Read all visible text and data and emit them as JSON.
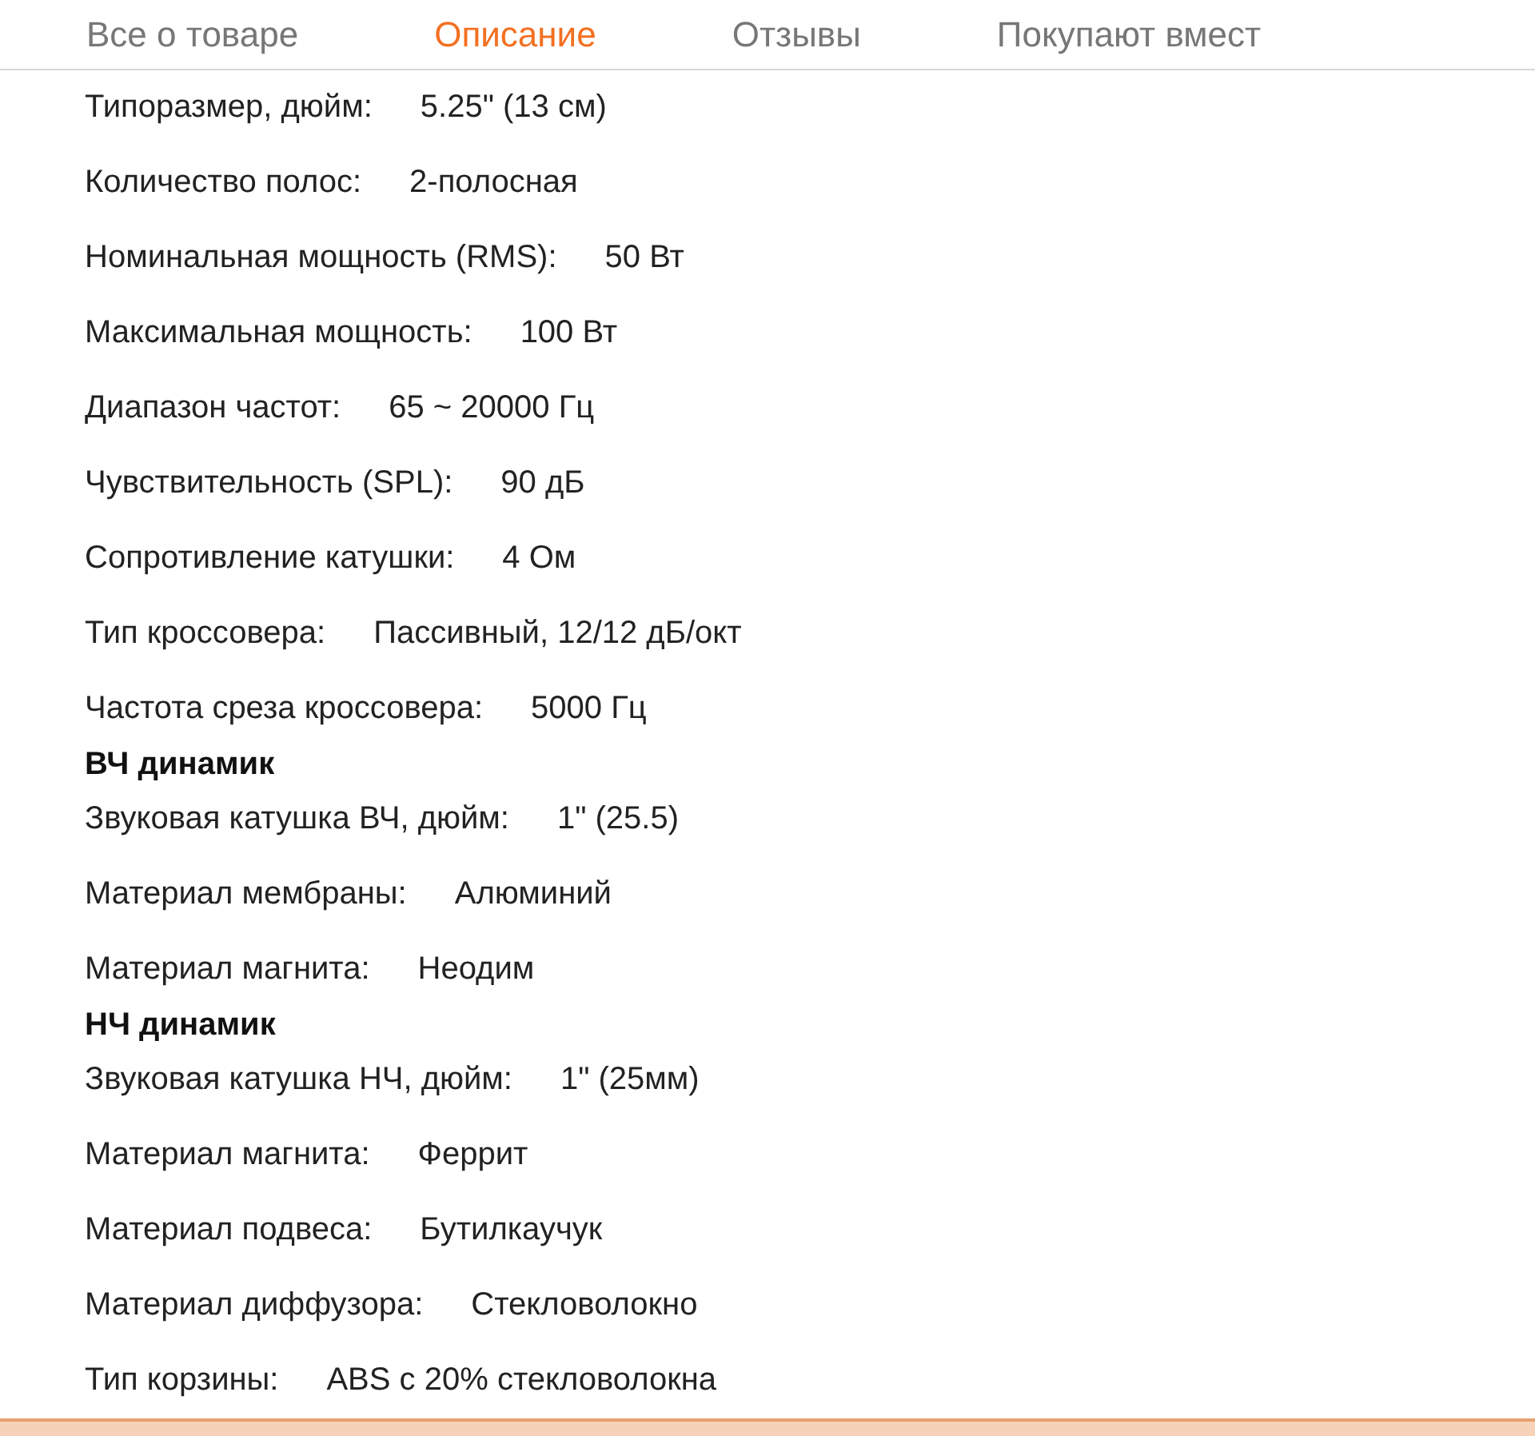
{
  "tabs": [
    {
      "label": "Все о товаре",
      "selected": false
    },
    {
      "label": "Описание",
      "selected": true
    },
    {
      "label": "Отзывы",
      "selected": false
    },
    {
      "label": "Покупают вмест",
      "selected": false
    }
  ],
  "specs": [
    {
      "kind": "row",
      "label": "Типоразмер, дюйм:",
      "value": "5.25\" (13 см)"
    },
    {
      "kind": "row",
      "label": "Количество полос:",
      "value": "2-полосная"
    },
    {
      "kind": "row",
      "label": "Номинальная мощность (RMS):",
      "value": "50 Вт"
    },
    {
      "kind": "row",
      "label": "Максимальная мощность:",
      "value": "100 Вт"
    },
    {
      "kind": "row",
      "label": "Диапазон частот:",
      "value": "65 ~ 20000 Гц"
    },
    {
      "kind": "row",
      "label": "Чувствительность (SPL):",
      "value": "90 дБ"
    },
    {
      "kind": "row",
      "label": "Сопротивление катушки:",
      "value": "4 Ом"
    },
    {
      "kind": "row",
      "label": "Тип кроссовера:",
      "value": "Пассивный, 12/12 дБ/окт"
    },
    {
      "kind": "row",
      "label": "Частота среза кроссовера:",
      "value": "5000 Гц"
    },
    {
      "kind": "heading",
      "label": "ВЧ динамик"
    },
    {
      "kind": "row",
      "label": "Звуковая катушка ВЧ, дюйм:",
      "value": "1\" (25.5)"
    },
    {
      "kind": "row",
      "label": "Материал мембраны:",
      "value": "Алюминий"
    },
    {
      "kind": "row",
      "label": "Материал магнита:",
      "value": "Неодим"
    },
    {
      "kind": "heading",
      "label": "НЧ динамик"
    },
    {
      "kind": "row",
      "label": "Звуковая катушка НЧ, дюйм:",
      "value": "1\" (25мм)"
    },
    {
      "kind": "row",
      "label": "Материал магнита:",
      "value": "Феррит"
    },
    {
      "kind": "row",
      "label": "Материал подвеса:",
      "value": "Бутилкаучук"
    },
    {
      "kind": "row",
      "label": "Материал диффузора:",
      "value": "Стекловолокно"
    },
    {
      "kind": "row",
      "label": "Тип корзины:",
      "value": "ABS с 20% стекловолокна"
    }
  ]
}
